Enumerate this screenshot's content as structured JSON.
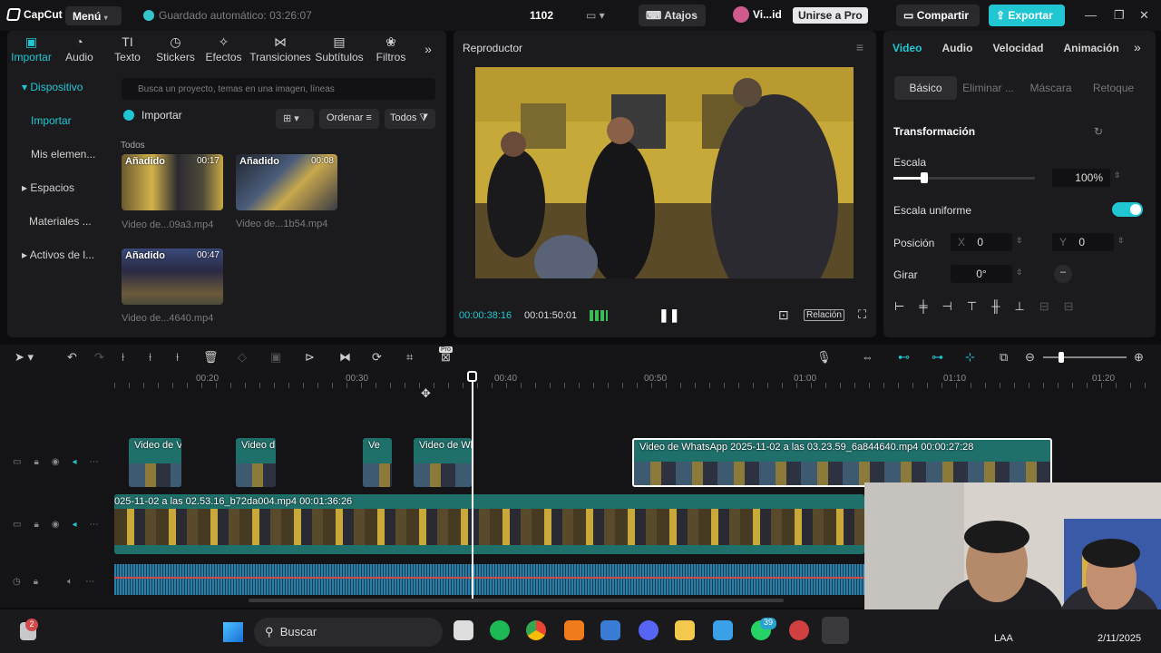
{
  "app": {
    "brand": "CapCut",
    "menu": "Menú",
    "autosave": "Guardado automático: 03:26:07",
    "count": "1102",
    "shortcuts": "Atajos",
    "user_short": "Vi...id",
    "pro_button": "Unirse a Pro",
    "share": "Compartir",
    "export": "Exportar",
    "accent": "#20c7d3"
  },
  "tools": [
    {
      "icon": "import-icon",
      "label": "Importar"
    },
    {
      "icon": "audio-icon",
      "label": "Audio"
    },
    {
      "icon": "text-icon",
      "label": "Texto"
    },
    {
      "icon": "stickers-icon",
      "label": "Stickers"
    },
    {
      "icon": "effects-icon",
      "label": "Efectos"
    },
    {
      "icon": "transitions-icon",
      "label": "Transiciones"
    },
    {
      "icon": "subtitles-icon",
      "label": "Subtítulos"
    },
    {
      "icon": "filters-icon",
      "label": "Filtros"
    }
  ],
  "sidebar": {
    "items": [
      "Dispositivo",
      "Importar",
      "Mis elemen...",
      "Espacios",
      "Materiales ...",
      "Activos de l..."
    ]
  },
  "media": {
    "search_placeholder": "Busca un proyecto, temas en una imagen, líneas",
    "import": "Importar",
    "sort": "Ordenar",
    "filter": "Todos",
    "section": "Todos",
    "items": [
      {
        "tag": "Añadido",
        "duration": "00:17",
        "name": "Video de...09a3.mp4"
      },
      {
        "tag": "Añadido",
        "duration": "00:08",
        "name": "Video de...1b54.mp4"
      },
      {
        "tag": "Añadido",
        "duration": "00:47",
        "name": "Video de...4640.mp4"
      }
    ]
  },
  "player": {
    "title": "Reproductor",
    "current": "00:00:38:16",
    "total": "00:01:50:01",
    "ratio": "Relación"
  },
  "properties": {
    "tabs": [
      "Video",
      "Audio",
      "Velocidad",
      "Animación"
    ],
    "subtabs": [
      "Básico",
      "Eliminar ...",
      "Máscara",
      "Retoque"
    ],
    "section": "Transformación",
    "scale_label": "Escala",
    "scale_value": "100%",
    "scale_fraction": 0.2,
    "uniform_label": "Escala uniforme",
    "uniform_on": true,
    "position_label": "Posición",
    "x_label": "X",
    "x_value": "0",
    "y_label": "Y",
    "y_value": "0",
    "rotate_label": "Girar",
    "rotate_value": "0°"
  },
  "timeline": {
    "ruler": [
      "00:20",
      "00:30",
      "00:40",
      "00:50",
      "01:00",
      "01:10",
      "01:20"
    ],
    "overlay_clips": [
      "Video de V",
      "Video d",
      "Ve",
      "Video de Wh"
    ],
    "long_clip": "Video de WhatsApp 2025-11-02 a las 03.23.59_6a844640.mp4  00:00:27:28",
    "main_clip": "025-11-02 a las 02.53.16_b72da004.mp4  00:01:36:26",
    "pro_badge": "Pro"
  },
  "taskbar": {
    "search": "Buscar",
    "lang": "LAA",
    "date": "2/11/2025",
    "notif_badge": "2",
    "whatsapp_badge": "39"
  }
}
